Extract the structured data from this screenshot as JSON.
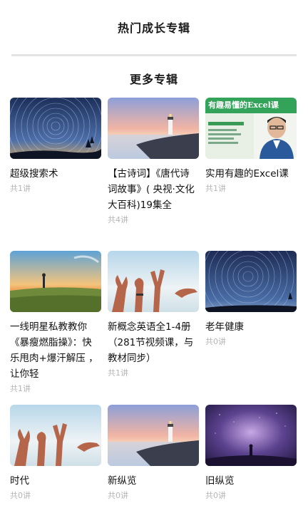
{
  "header": {
    "title": "热门成长专辑"
  },
  "section": {
    "title": "更多专辑"
  },
  "albums": [
    {
      "title": "超级搜索术",
      "meta": "共1讲"
    },
    {
      "title": "【古诗词】《唐代诗词故事》( 央视·文化大百科)19集全",
      "meta": "共4讲"
    },
    {
      "title": "实用有趣的Excel课",
      "meta": "共1讲"
    },
    {
      "title": "一线明星私教教你《暴瘦燃脂操》：快乐甩肉+爆汗解压 ，让你轻",
      "meta": "共1讲"
    },
    {
      "title": "新概念英语全1-4册（281节视频课，与教材同步）",
      "meta": "共1讲"
    },
    {
      "title": "老年健康",
      "meta": "共0讲"
    },
    {
      "title": "时代",
      "meta": "共0讲"
    },
    {
      "title": "新纵览",
      "meta": "共0讲"
    },
    {
      "title": "旧纵览",
      "meta": "共0讲"
    }
  ],
  "thumb_labels": {
    "excel": "有趣易懂的Excel课"
  },
  "icons": {
    "star_trails": "star-trails-thumbnail",
    "lighthouse": "lighthouse-thumbnail",
    "excel": "excel-course-thumbnail",
    "meadow": "meadow-thumbnail",
    "hands": "hand-gestures-thumbnail",
    "galaxy": "purple-sky-thumbnail"
  }
}
